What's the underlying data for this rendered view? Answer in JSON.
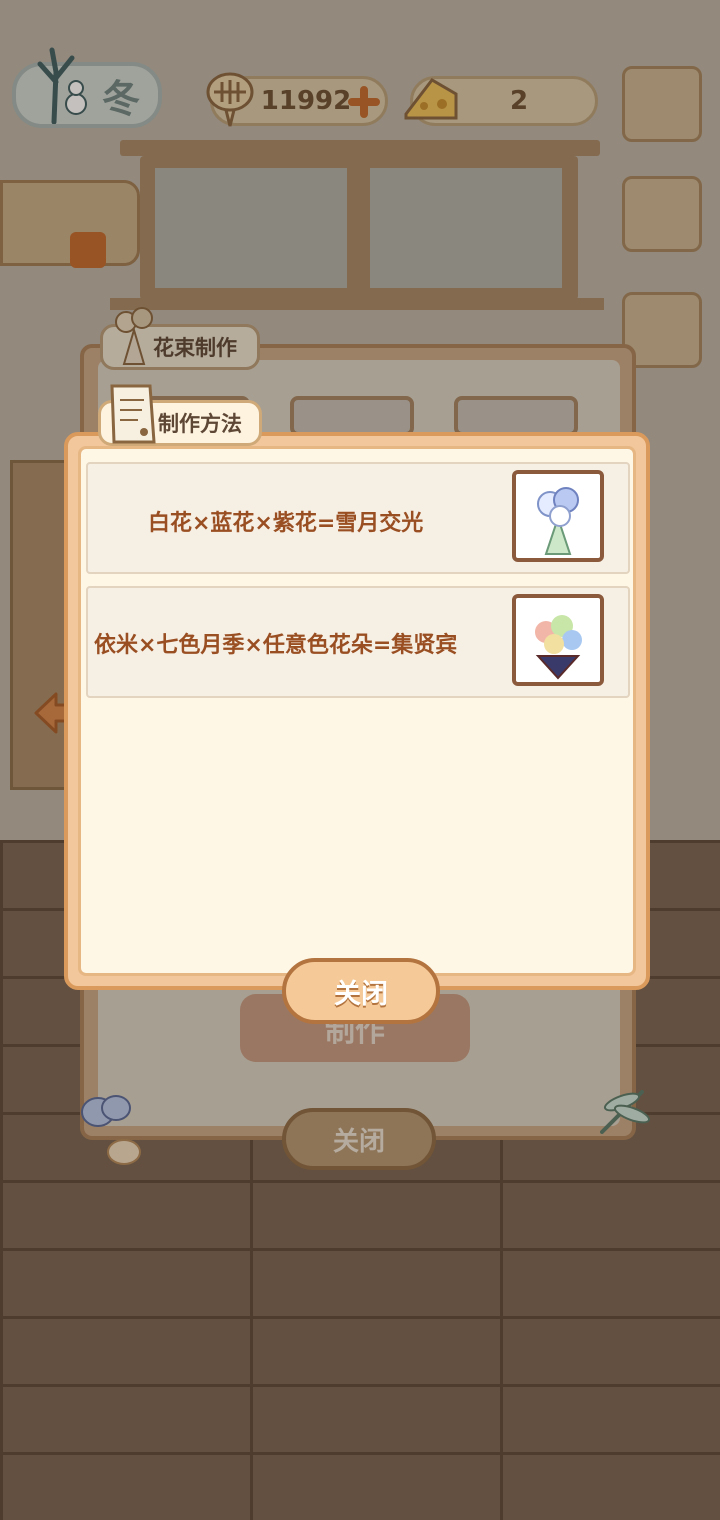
{
  "header": {
    "season": "冬",
    "fish_count": "11992",
    "cheese_count": "2"
  },
  "back_window": {
    "tab_label": "花束制作",
    "make_button": "制作",
    "close_button": "关闭"
  },
  "recipe_dialog": {
    "tab_label": "制作方法",
    "recipes": [
      {
        "text": "白花×蓝花×紫花=雪月交光",
        "thumb_icon": "white-blue-bouquet-icon"
      },
      {
        "text": "依米×七色月季×任意色花朵=集贤宾",
        "thumb_icon": "rainbow-rose-bouquet-icon"
      }
    ],
    "close_button": "关闭"
  },
  "colors": {
    "accent_orange": "#d99a5c",
    "text_brown": "#9a4f22",
    "panel_cream": "#fff7e6"
  }
}
